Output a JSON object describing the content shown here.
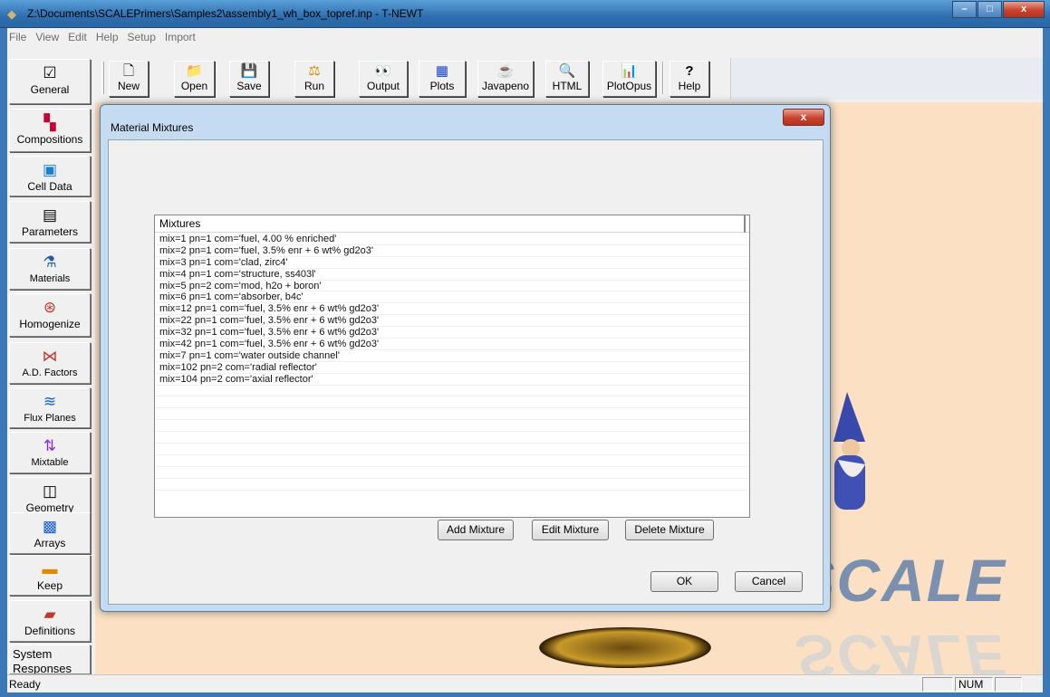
{
  "window": {
    "title": "Z:\\Documents\\SCALEPrimers\\Samples2\\assembly1_wh_box_topref.inp - T-NEWT",
    "minimize": "–",
    "maximize": "□",
    "close": "x"
  },
  "menu": [
    "File",
    "View",
    "Edit",
    "Help",
    "Setup",
    "Import"
  ],
  "toolbar": [
    {
      "label": "New",
      "icon": "new-document-icon",
      "glyph": "🗋"
    },
    {
      "label": "Open",
      "icon": "folder-icon",
      "glyph": "📁"
    },
    {
      "label": "Save",
      "icon": "floppy-disk-icon",
      "glyph": "💾"
    },
    {
      "label": "Run",
      "icon": "balance-scale-icon",
      "glyph": "⚖"
    },
    {
      "label": "Output",
      "icon": "eyes-icon",
      "glyph": "👀"
    },
    {
      "label": "Plots",
      "icon": "grid-chart-icon",
      "glyph": "▦"
    },
    {
      "label": "Javapeno",
      "icon": "coffee-cup-icon",
      "glyph": "☕"
    },
    {
      "label": "HTML",
      "icon": "magnifier-page-icon",
      "glyph": "🔍"
    },
    {
      "label": "PlotOpus",
      "icon": "plot-icon",
      "glyph": "📊"
    },
    {
      "label": "Help",
      "icon": "question-mark-icon",
      "glyph": "?"
    }
  ],
  "sidebar": [
    {
      "label": "General",
      "icon": "checklist-icon",
      "glyph": "☑"
    },
    {
      "label": "Compositions",
      "icon": "colored-grid-icon",
      "glyph": "▚"
    },
    {
      "label": "Cell Data",
      "icon": "cell-icon",
      "glyph": "▣"
    },
    {
      "label": "Parameters",
      "icon": "parameter-table-icon",
      "glyph": "▤"
    },
    {
      "label": "Materials",
      "icon": "materials-icon",
      "glyph": "⚗"
    },
    {
      "label": "Homogenize",
      "icon": "homogenize-icon",
      "glyph": "⊛"
    },
    {
      "label": "A.D. Factors",
      "icon": "adjoint-factors-icon",
      "glyph": "⋈"
    },
    {
      "label": "Flux Planes",
      "icon": "flux-planes-icon",
      "glyph": "≋"
    },
    {
      "label": "Mixtable",
      "icon": "mixtable-icon",
      "glyph": "⇅"
    },
    {
      "label": "Geometry",
      "icon": "cube-icon",
      "glyph": "◫"
    },
    {
      "label": "Arrays",
      "icon": "array-icon",
      "glyph": "▩"
    },
    {
      "label": "Keep",
      "icon": "keep-icon",
      "glyph": "▬"
    },
    {
      "label": "Definitions",
      "icon": "definitions-icon",
      "glyph": "▰"
    },
    {
      "label": "System Responses",
      "icon": "",
      "glyph": ""
    }
  ],
  "dialog": {
    "title": "Material Mixtures",
    "close": "x",
    "list_header": "Mixtures",
    "mixtures": [
      "mix=1 pn=1 com='fuel, 4.00 % enriched'",
      "mix=2 pn=1 com='fuel, 3.5% enr + 6 wt% gd2o3'",
      "mix=3 pn=1 com='clad, zirc4'",
      "mix=4 pn=1 com='structure, ss403l'",
      "mix=5 pn=2 com='mod, h2o + boron'",
      "mix=6 pn=1 com='absorber, b4c'",
      "mix=12 pn=1 com='fuel, 3.5% enr + 6 wt% gd2o3'",
      "mix=22 pn=1 com='fuel, 3.5% enr + 6 wt% gd2o3'",
      "mix=32 pn=1 com='fuel, 3.5% enr + 6 wt% gd2o3'",
      "mix=42 pn=1 com='fuel, 3.5% enr + 6 wt% gd2o3'",
      "mix=7 pn=1 com='water outside channel'",
      "mix=102 pn=2 com='radial reflector'",
      "mix=104 pn=2 com='axial reflector'"
    ],
    "add_button": "Add Mixture",
    "edit_button": "Edit Mixture",
    "delete_button": "Delete Mixture",
    "ok_button": "OK",
    "cancel_button": "Cancel"
  },
  "status": {
    "text": "Ready",
    "num": "NUM"
  }
}
